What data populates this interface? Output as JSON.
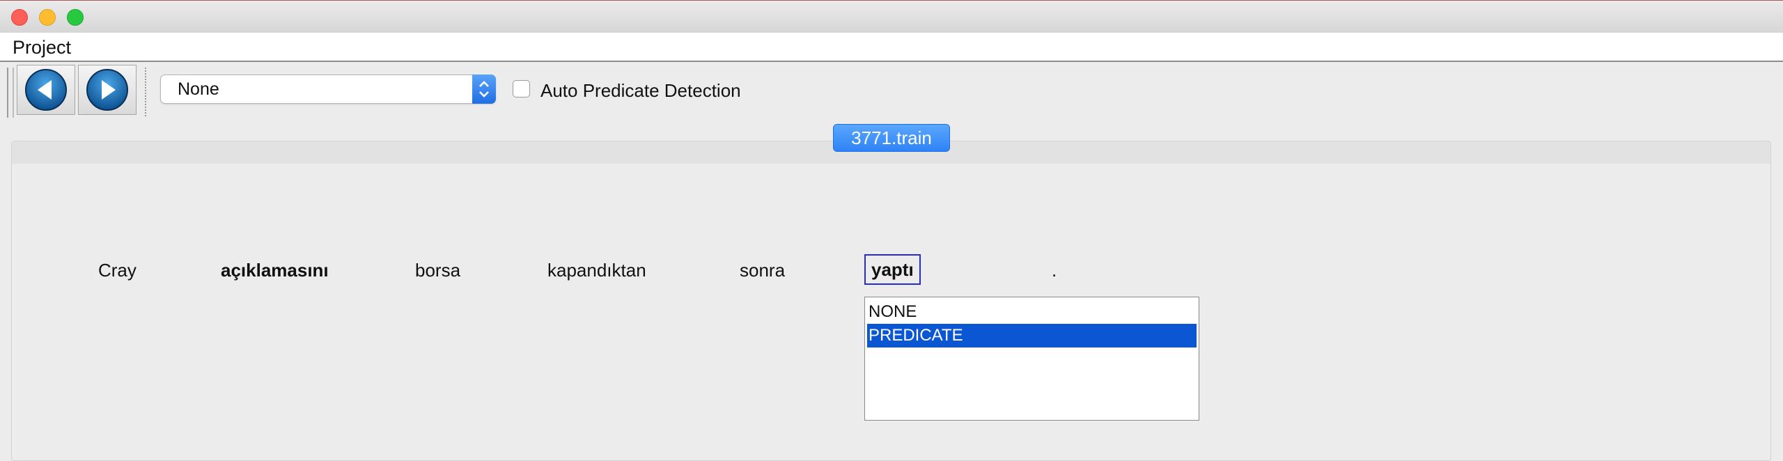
{
  "menubar": {
    "project": "Project"
  },
  "toolbar": {
    "prev_icon": "arrow-left-icon",
    "next_icon": "arrow-right-icon",
    "combo_value": "None",
    "auto_detect_label": "Auto Predicate Detection",
    "auto_detect_checked": false
  },
  "tab": {
    "label": "3771.train"
  },
  "sentence": {
    "words": [
      "Cray",
      "açıklamasını",
      "borsa",
      "kapandıktan",
      "sonra",
      "yaptı",
      "."
    ],
    "selected_word": "yaptı"
  },
  "list": {
    "options": [
      "NONE",
      "PREDICATE"
    ],
    "selected": "PREDICATE"
  },
  "colors": {
    "accent": "#2f83f5",
    "selection": "#0b56d3",
    "word_border": "#2a2ad0"
  }
}
